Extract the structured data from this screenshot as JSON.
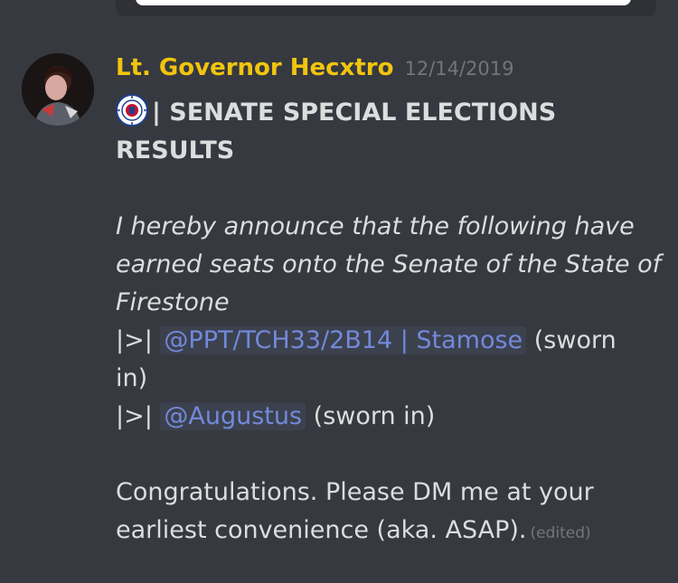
{
  "message": {
    "author": "Lt. Governor Hecxtro",
    "timestamp": "12/14/2019",
    "author_color": "#f1c40f",
    "mention_color": "#7289da",
    "title_prefix": "| ",
    "title_line1": "SENATE SPECIAL ELECTIONS",
    "title_line2": "RESULTS",
    "announce_line1": "I hereby announce that the following have",
    "announce_line2": "earned seats onto the Senate of the State of",
    "announce_line3": "Firestone",
    "entries": [
      {
        "prefix": "|>| ",
        "mention": "@PPT/TCH33/2B14 | Stamose",
        "suffix": " (sworn",
        "suffix_continued": "in)"
      },
      {
        "prefix": "|>| ",
        "mention": "@Augustus",
        "suffix": " (sworn in)"
      }
    ],
    "closing_line1": "Congratulations. Please DM me at your",
    "closing_line2": "earliest convenience (aka. ASAP).",
    "edited_label": "(edited)",
    "icons": {
      "avatar": "user-avatar",
      "seal": "state-seal-icon"
    }
  }
}
